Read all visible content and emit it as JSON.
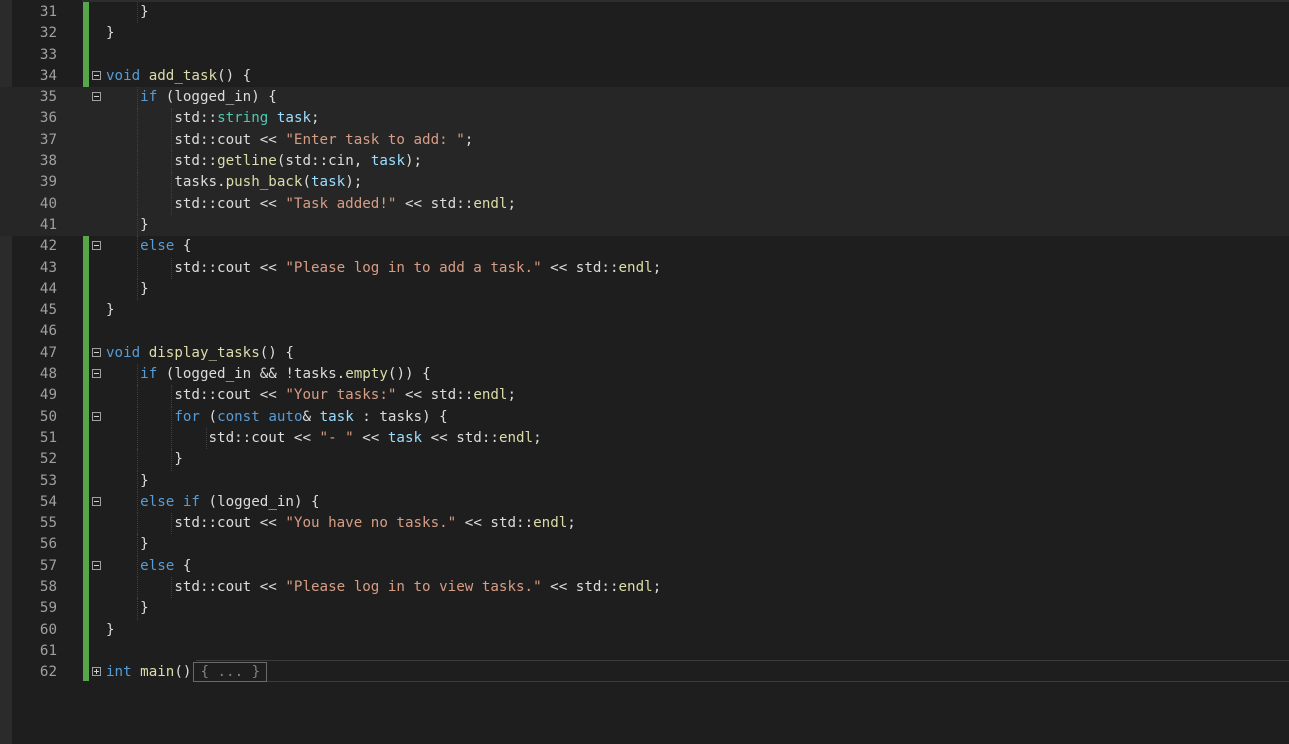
{
  "lines": [
    {
      "num": "31",
      "indent": "    ",
      "tokens": [
        {
          "t": "}",
          "c": "plain"
        }
      ]
    },
    {
      "num": "32",
      "indent": "",
      "tokens": [
        {
          "t": "}",
          "c": "plain"
        }
      ]
    },
    {
      "num": "33",
      "indent": "",
      "tokens": []
    },
    {
      "num": "34",
      "indent": "",
      "fold": "minus",
      "tokens": [
        {
          "t": "void",
          "c": "kw"
        },
        {
          "t": " ",
          "c": "plain"
        },
        {
          "t": "add_task",
          "c": "fn"
        },
        {
          "t": "() {",
          "c": "plain"
        }
      ]
    },
    {
      "num": "35",
      "indent": "    ",
      "fold": "minus",
      "current": true,
      "tokens": [
        {
          "t": "if",
          "c": "kw"
        },
        {
          "t": " (logged_in) {",
          "c": "plain"
        }
      ]
    },
    {
      "num": "36",
      "indent": "        ",
      "current": true,
      "tokens": [
        {
          "t": "std::",
          "c": "plain"
        },
        {
          "t": "string",
          "c": "ty"
        },
        {
          "t": " ",
          "c": "plain"
        },
        {
          "t": "task",
          "c": "var"
        },
        {
          "t": ";",
          "c": "plain"
        }
      ]
    },
    {
      "num": "37",
      "indent": "        ",
      "current": true,
      "tokens": [
        {
          "t": "std::cout << ",
          "c": "plain"
        },
        {
          "t": "\"Enter task to add: \"",
          "c": "str"
        },
        {
          "t": ";",
          "c": "plain"
        }
      ]
    },
    {
      "num": "38",
      "indent": "        ",
      "current": true,
      "tokens": [
        {
          "t": "std::",
          "c": "plain"
        },
        {
          "t": "getline",
          "c": "fn"
        },
        {
          "t": "(std::cin, ",
          "c": "plain"
        },
        {
          "t": "task",
          "c": "var"
        },
        {
          "t": ");",
          "c": "plain"
        }
      ]
    },
    {
      "num": "39",
      "indent": "        ",
      "current": true,
      "tokens": [
        {
          "t": "tasks.",
          "c": "plain"
        },
        {
          "t": "push_back",
          "c": "fn"
        },
        {
          "t": "(",
          "c": "plain"
        },
        {
          "t": "task",
          "c": "var"
        },
        {
          "t": ");",
          "c": "plain"
        }
      ]
    },
    {
      "num": "40",
      "indent": "        ",
      "current": true,
      "tokens": [
        {
          "t": "std::cout << ",
          "c": "plain"
        },
        {
          "t": "\"Task added!\"",
          "c": "str"
        },
        {
          "t": " << std::",
          "c": "plain"
        },
        {
          "t": "endl",
          "c": "fn"
        },
        {
          "t": ";",
          "c": "plain"
        }
      ]
    },
    {
      "num": "41",
      "indent": "    ",
      "current": true,
      "tokens": [
        {
          "t": "}",
          "c": "plain"
        }
      ]
    },
    {
      "num": "42",
      "indent": "    ",
      "fold": "minus",
      "tokens": [
        {
          "t": "else",
          "c": "kw"
        },
        {
          "t": " {",
          "c": "plain"
        }
      ]
    },
    {
      "num": "43",
      "indent": "        ",
      "tokens": [
        {
          "t": "std::cout << ",
          "c": "plain"
        },
        {
          "t": "\"Please log in to add a task.\"",
          "c": "str"
        },
        {
          "t": " << std::",
          "c": "plain"
        },
        {
          "t": "endl",
          "c": "fn"
        },
        {
          "t": ";",
          "c": "plain"
        }
      ]
    },
    {
      "num": "44",
      "indent": "    ",
      "tokens": [
        {
          "t": "}",
          "c": "plain"
        }
      ]
    },
    {
      "num": "45",
      "indent": "",
      "tokens": [
        {
          "t": "}",
          "c": "plain"
        }
      ]
    },
    {
      "num": "46",
      "indent": "",
      "tokens": []
    },
    {
      "num": "47",
      "indent": "",
      "fold": "minus",
      "tokens": [
        {
          "t": "void",
          "c": "kw"
        },
        {
          "t": " ",
          "c": "plain"
        },
        {
          "t": "display_tasks",
          "c": "fn"
        },
        {
          "t": "() {",
          "c": "plain"
        }
      ]
    },
    {
      "num": "48",
      "indent": "    ",
      "fold": "minus",
      "tokens": [
        {
          "t": "if",
          "c": "kw"
        },
        {
          "t": " (logged_in && !tasks.",
          "c": "plain"
        },
        {
          "t": "empty",
          "c": "fn"
        },
        {
          "t": "()) {",
          "c": "plain"
        }
      ]
    },
    {
      "num": "49",
      "indent": "        ",
      "tokens": [
        {
          "t": "std::cout << ",
          "c": "plain"
        },
        {
          "t": "\"Your tasks:\"",
          "c": "str"
        },
        {
          "t": " << std::",
          "c": "plain"
        },
        {
          "t": "endl",
          "c": "fn"
        },
        {
          "t": ";",
          "c": "plain"
        }
      ]
    },
    {
      "num": "50",
      "indent": "        ",
      "fold": "minus",
      "tokens": [
        {
          "t": "for",
          "c": "kw"
        },
        {
          "t": " (",
          "c": "plain"
        },
        {
          "t": "const",
          "c": "kw"
        },
        {
          "t": " ",
          "c": "plain"
        },
        {
          "t": "auto",
          "c": "kw"
        },
        {
          "t": "& ",
          "c": "plain"
        },
        {
          "t": "task",
          "c": "var"
        },
        {
          "t": " : tasks) {",
          "c": "plain"
        }
      ]
    },
    {
      "num": "51",
      "indent": "            ",
      "tokens": [
        {
          "t": "std::cout << ",
          "c": "plain"
        },
        {
          "t": "\"- \"",
          "c": "str"
        },
        {
          "t": " << ",
          "c": "plain"
        },
        {
          "t": "task",
          "c": "var"
        },
        {
          "t": " << std::",
          "c": "plain"
        },
        {
          "t": "endl",
          "c": "fn"
        },
        {
          "t": ";",
          "c": "plain"
        }
      ]
    },
    {
      "num": "52",
      "indent": "        ",
      "tokens": [
        {
          "t": "}",
          "c": "plain"
        }
      ]
    },
    {
      "num": "53",
      "indent": "    ",
      "tokens": [
        {
          "t": "}",
          "c": "plain"
        }
      ]
    },
    {
      "num": "54",
      "indent": "    ",
      "fold": "minus",
      "tokens": [
        {
          "t": "else",
          "c": "kw"
        },
        {
          "t": " ",
          "c": "plain"
        },
        {
          "t": "if",
          "c": "kw"
        },
        {
          "t": " (logged_in) {",
          "c": "plain"
        }
      ]
    },
    {
      "num": "55",
      "indent": "        ",
      "tokens": [
        {
          "t": "std::cout << ",
          "c": "plain"
        },
        {
          "t": "\"You have no tasks.\"",
          "c": "str"
        },
        {
          "t": " << std::",
          "c": "plain"
        },
        {
          "t": "endl",
          "c": "fn"
        },
        {
          "t": ";",
          "c": "plain"
        }
      ]
    },
    {
      "num": "56",
      "indent": "    ",
      "tokens": [
        {
          "t": "}",
          "c": "plain"
        }
      ]
    },
    {
      "num": "57",
      "indent": "    ",
      "fold": "minus",
      "tokens": [
        {
          "t": "else",
          "c": "kw"
        },
        {
          "t": " {",
          "c": "plain"
        }
      ]
    },
    {
      "num": "58",
      "indent": "        ",
      "tokens": [
        {
          "t": "std::cout << ",
          "c": "plain"
        },
        {
          "t": "\"Please log in to view tasks.\"",
          "c": "str"
        },
        {
          "t": " << std::",
          "c": "plain"
        },
        {
          "t": "endl",
          "c": "fn"
        },
        {
          "t": ";",
          "c": "plain"
        }
      ]
    },
    {
      "num": "59",
      "indent": "    ",
      "tokens": [
        {
          "t": "}",
          "c": "plain"
        }
      ]
    },
    {
      "num": "60",
      "indent": "",
      "tokens": [
        {
          "t": "}",
          "c": "plain"
        }
      ]
    },
    {
      "num": "61",
      "indent": "",
      "tokens": []
    },
    {
      "num": "62",
      "indent": "",
      "fold": "plus",
      "collapsed": "{ ... }",
      "tokens": [
        {
          "t": "int",
          "c": "kw"
        },
        {
          "t": " ",
          "c": "plain"
        },
        {
          "t": "main",
          "c": "fn"
        },
        {
          "t": "()",
          "c": "plain"
        }
      ]
    }
  ],
  "colors": {
    "background": "#1e1e1e",
    "keyword": "#569cd6",
    "type": "#4ec9b0",
    "function": "#dcdcaa",
    "string": "#d69d85",
    "variable": "#9cdcfe",
    "change_bar": "#57a64a"
  }
}
